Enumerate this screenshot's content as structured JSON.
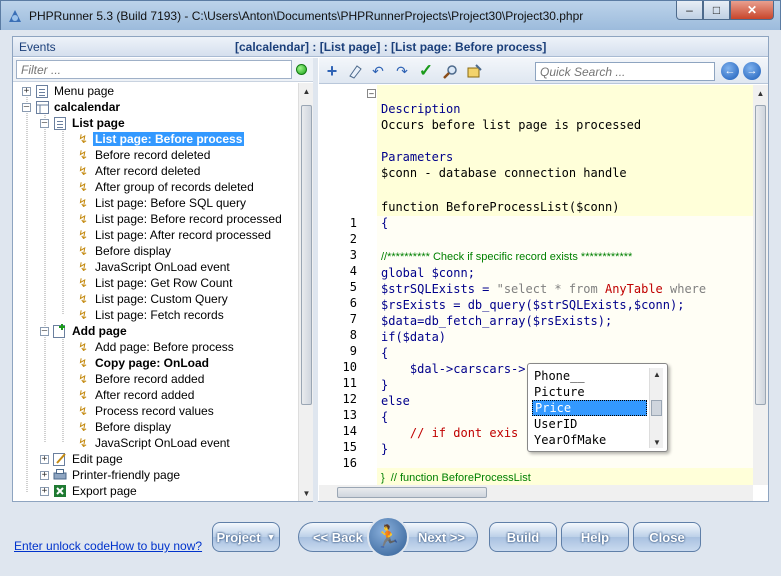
{
  "window": {
    "title": "PHPRunner 5.3 (Build 7193) - C:\\Users\\Anton\\Documents\\PHPRunnerProjects\\Project30\\Project30.phpr"
  },
  "header": {
    "events_label": "Events",
    "breadcrumb": "[calcalendar] : [List page] : [List page: Before process]"
  },
  "filter": {
    "placeholder": "Filter ..."
  },
  "tree": {
    "menu_page": "Menu page",
    "table": "calcalendar",
    "list_page": "List page",
    "list_events": [
      "List page: Before process",
      "Before record deleted",
      "After record deleted",
      "After group of records deleted",
      "List page: Before SQL query",
      "List page: Before record processed",
      "List page: After record processed",
      "Before display",
      "JavaScript OnLoad event",
      "List page: Get Row Count",
      "List page: Custom Query",
      "List page: Fetch records"
    ],
    "add_page": "Add page",
    "add_events": [
      "Add page: Before process",
      "Copy page: OnLoad",
      "Before record added",
      "After record added",
      "Process record values",
      "Before display",
      "JavaScript OnLoad event"
    ],
    "edit_page": "Edit page",
    "printer_page": "Printer-friendly page",
    "export_page": "Export page"
  },
  "toolbar": {
    "quick_search_placeholder": "Quick Search ..."
  },
  "editor": {
    "desc_title": "Description",
    "desc_text": "Occurs before list page is processed",
    "params_title": "Parameters",
    "params_text": "$conn - database connection handle",
    "func_sig": "function BeforeProcessList($conn)",
    "open_brace": "{",
    "line_numbers": [
      "1",
      "2",
      "3",
      "4",
      "5",
      "6",
      "7",
      "8",
      "9",
      "10",
      "11",
      "12",
      "13",
      "14",
      "15",
      "16"
    ],
    "footer": "}  // function BeforeProcessList",
    "comment_line": "//********** Check if specific record exists ************",
    "l3": "global $conn;",
    "l4a": "$strSQLExists = ",
    "l4b": "\"select * from ",
    "l4c": "AnyTable",
    "l4d": " where",
    "l5": "$rsExists = db_query($strSQLExists,$conn);",
    "l6": "$data=db_fetch_array($rsExists);",
    "l7": "if($data)",
    "l8": "{",
    "l9": "    $dal->carscars->",
    "l10": "}",
    "l11": "else",
    "l12": "{",
    "l13a": "    // if dont exis",
    "l13b": "e",
    "l14": "}"
  },
  "autocomplete": {
    "items": [
      "Phone__",
      "Picture",
      "Price",
      "UserID",
      "YearOfMake"
    ],
    "selected": "Price"
  },
  "bottom": {
    "unlock_link": "Enter unlock code",
    "buy_link": "How to buy now?",
    "project_btn": "Project",
    "back_btn": "<< Back",
    "next_btn": "Next >>",
    "build_btn": "Build",
    "help_btn": "Help",
    "close_btn": "Close"
  }
}
